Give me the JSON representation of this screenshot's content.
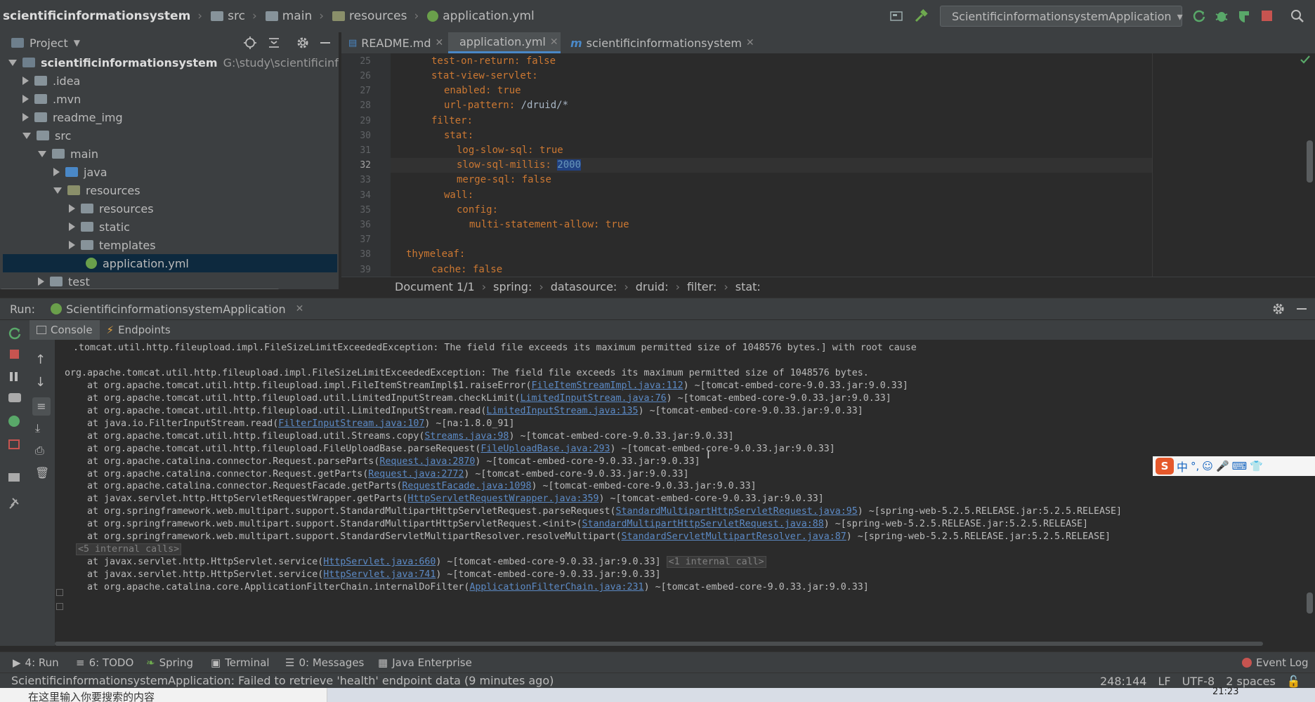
{
  "navbar": {
    "breadcrumbs": [
      "scientificinformationsystem",
      "src",
      "main",
      "resources",
      "application.yml"
    ],
    "run_config": "ScientificinformationsystemApplication"
  },
  "project": {
    "title": "Project",
    "root_name": "scientificinformationsystem",
    "root_path": "G:\\study\\scientificinformatio",
    "items": [
      {
        "label": ".idea"
      },
      {
        "label": ".mvn"
      },
      {
        "label": "readme_img"
      },
      {
        "label": "src"
      },
      {
        "label": "main"
      },
      {
        "label": "java"
      },
      {
        "label": "resources"
      },
      {
        "label": "resources"
      },
      {
        "label": "static"
      },
      {
        "label": "templates"
      },
      {
        "label": "application.yml"
      },
      {
        "label": "test"
      }
    ]
  },
  "editor": {
    "tabs": [
      {
        "label": "README.md"
      },
      {
        "label": "application.yml"
      },
      {
        "label": "scientificinformationsystem"
      }
    ],
    "lines": [
      {
        "n": "25",
        "key": "test-on-return:",
        "val": " false"
      },
      {
        "n": "26",
        "key": "stat-view-servlet:",
        "val": ""
      },
      {
        "n": "27",
        "key": "enabled:",
        "val": " true"
      },
      {
        "n": "28",
        "key": "url-pattern:",
        "val": " /druid/*"
      },
      {
        "n": "29",
        "key": "filter:",
        "val": ""
      },
      {
        "n": "30",
        "key": "stat:",
        "val": ""
      },
      {
        "n": "31",
        "key": "log-slow-sql:",
        "val": " true"
      },
      {
        "n": "32",
        "key": "slow-sql-millis:",
        "val": "2000"
      },
      {
        "n": "33",
        "key": "merge-sql:",
        "val": " false"
      },
      {
        "n": "34",
        "key": "wall:",
        "val": ""
      },
      {
        "n": "35",
        "key": "config:",
        "val": ""
      },
      {
        "n": "36",
        "key": "multi-statement-allow:",
        "val": " true"
      },
      {
        "n": "37",
        "key": "",
        "val": ""
      },
      {
        "n": "38",
        "key": "thymeleaf:",
        "val": ""
      },
      {
        "n": "39",
        "key": "cache:",
        "val": " false"
      }
    ],
    "crumbs": [
      "Document 1/1",
      "spring:",
      "datasource:",
      "druid:",
      "filter:",
      "stat:"
    ]
  },
  "run": {
    "label": "Run:",
    "config": "ScientificinformationsystemApplication",
    "tabs": [
      "Console",
      "Endpoints"
    ],
    "console": [
      {
        "pre": ".tomcat.util.http.fileupload.impl.FileSizeLimitExceededException: The field file exceeds its maximum permitted size of 1048576 bytes.] with root cause",
        "link": "",
        "post": ""
      },
      {
        "pre": "",
        "link": "",
        "post": ""
      },
      {
        "pre": "org.apache.tomcat.util.http.fileupload.impl.FileSizeLimitExceededException: The field file exceeds its maximum permitted size of 1048576 bytes.",
        "link": "",
        "post": ""
      },
      {
        "pre": "    at org.apache.tomcat.util.http.fileupload.impl.FileItemStreamImpl$1.raiseError(",
        "link": "FileItemStreamImpl.java:112",
        "post": ") ~[tomcat-embed-core-9.0.33.jar:9.0.33]"
      },
      {
        "pre": "    at org.apache.tomcat.util.http.fileupload.util.LimitedInputStream.checkLimit(",
        "link": "LimitedInputStream.java:76",
        "post": ") ~[tomcat-embed-core-9.0.33.jar:9.0.33]"
      },
      {
        "pre": "    at org.apache.tomcat.util.http.fileupload.util.LimitedInputStream.read(",
        "link": "LimitedInputStream.java:135",
        "post": ") ~[tomcat-embed-core-9.0.33.jar:9.0.33]"
      },
      {
        "pre": "    at java.io.FilterInputStream.read(",
        "link": "FilterInputStream.java:107",
        "post": ") ~[na:1.8.0_91]"
      },
      {
        "pre": "    at org.apache.tomcat.util.http.fileupload.util.Streams.copy(",
        "link": "Streams.java:98",
        "post": ") ~[tomcat-embed-core-9.0.33.jar:9.0.33]"
      },
      {
        "pre": "    at org.apache.tomcat.util.http.fileupload.FileUploadBase.parseRequest(",
        "link": "FileUploadBase.java:293",
        "post": ") ~[tomcat-embed-core-9.0.33.jar:9.0.33]"
      },
      {
        "pre": "    at org.apache.catalina.connector.Request.parseParts(",
        "link": "Request.java:2870",
        "post": ") ~[tomcat-embed-core-9.0.33.jar:9.0.33]"
      },
      {
        "pre": "    at org.apache.catalina.connector.Request.getParts(",
        "link": "Request.java:2772",
        "post": ") ~[tomcat-embed-core-9.0.33.jar:9.0.33]"
      },
      {
        "pre": "    at org.apache.catalina.connector.RequestFacade.getParts(",
        "link": "RequestFacade.java:1098",
        "post": ") ~[tomcat-embed-core-9.0.33.jar:9.0.33]"
      },
      {
        "pre": "    at javax.servlet.http.HttpServletRequestWrapper.getParts(",
        "link": "HttpServletRequestWrapper.java:359",
        "post": ") ~[tomcat-embed-core-9.0.33.jar:9.0.33]"
      },
      {
        "pre": "    at org.springframework.web.multipart.support.StandardMultipartHttpServletRequest.parseRequest(",
        "link": "StandardMultipartHttpServletRequest.java:95",
        "post": ") ~[spring-web-5.2.5.RELEASE.jar:5.2.5.RELEASE]"
      },
      {
        "pre": "    at org.springframework.web.multipart.support.StandardMultipartHttpServletRequest.<init>(",
        "link": "StandardMultipartHttpServletRequest.java:88",
        "post": ") ~[spring-web-5.2.5.RELEASE.jar:5.2.5.RELEASE]"
      },
      {
        "pre": "    at org.springframework.web.multipart.support.StandardServletMultipartResolver.resolveMultipart(",
        "link": "StandardServletMultipartResolver.java:87",
        "post": ") ~[spring-web-5.2.5.RELEASE.jar:5.2.5.RELEASE]"
      },
      {
        "pre": "",
        "link": "",
        "post": "",
        "badge": "<5 internal calls>"
      },
      {
        "pre": "    at javax.servlet.http.HttpServlet.service(",
        "link": "HttpServlet.java:660",
        "post": ") ~[tomcat-embed-core-9.0.33.jar:9.0.33] ",
        "badge": "<1 internal call>"
      },
      {
        "pre": "    at javax.servlet.http.HttpServlet.service(",
        "link": "HttpServlet.java:741",
        "post": ") ~[tomcat-embed-core-9.0.33.jar:9.0.33]"
      },
      {
        "pre": "    at org.apache.catalina.core.ApplicationFilterChain.internalDoFilter(",
        "link": "ApplicationFilterChain.java:231",
        "post": ") ~[tomcat-embed-core-9.0.33.jar:9.0.33]"
      }
    ]
  },
  "toolwindows": [
    {
      "label": "4: Run"
    },
    {
      "label": "6: TODO"
    },
    {
      "label": "Spring"
    },
    {
      "label": "Terminal"
    },
    {
      "label": "0: Messages"
    },
    {
      "label": "Java Enterprise"
    }
  ],
  "event_log": "Event Log",
  "status": {
    "message": "ScientificinformationsystemApplication: Failed to retrieve 'health' endpoint data (9 minutes ago)",
    "position": "248:144",
    "line_sep": "LF",
    "encoding": "UTF-8",
    "indent": "2 spaces"
  },
  "taskbar": {
    "search_placeholder": "在这里输入你要搜索的内容",
    "time": "21:23"
  },
  "ime": {
    "label": "中"
  },
  "colors": {
    "accent": "#4a88c7",
    "selection": "#0d293e",
    "link": "#5c8ac5",
    "key": "#cc7832"
  }
}
